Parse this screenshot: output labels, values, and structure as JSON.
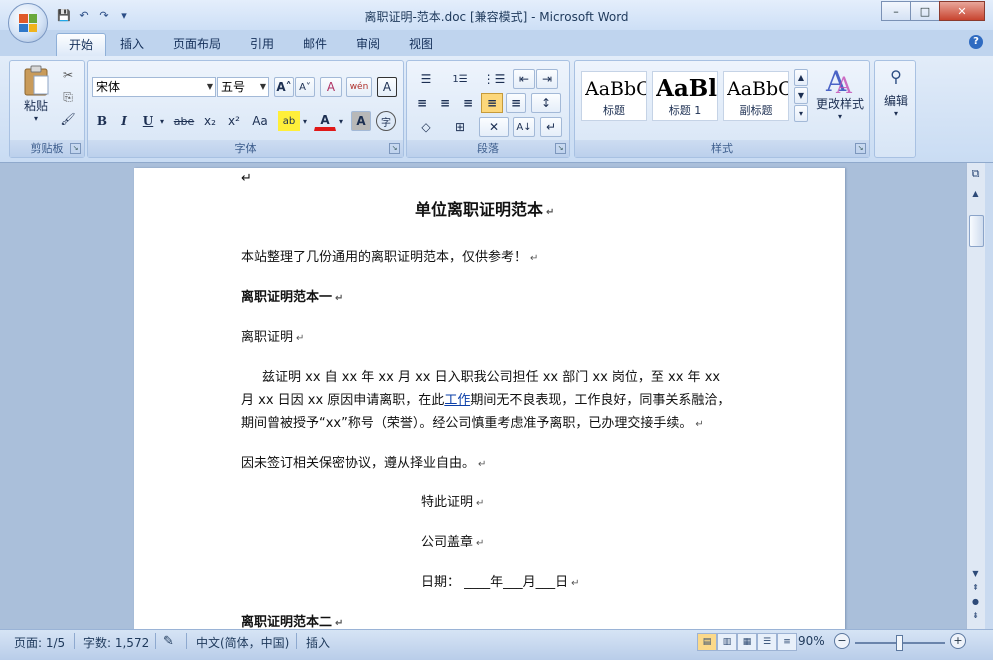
{
  "window": {
    "title": "离职证明-范本.doc [兼容模式] - Microsoft Word",
    "minimize": "–",
    "maximize": "□",
    "close": "✕"
  },
  "qat": {
    "save": "💾",
    "undo": "↶",
    "redo": "↷",
    "more": "▾"
  },
  "tabs": [
    "开始",
    "插入",
    "页面布局",
    "引用",
    "邮件",
    "审阅",
    "视图"
  ],
  "help": "?",
  "ribbon": {
    "clipboard": {
      "label": "剪贴板",
      "paste": "粘贴",
      "paste_arrow": "▾",
      "cut": "✂",
      "copy": "⎘",
      "format_painter": "🖌"
    },
    "font": {
      "label": "字体",
      "font_name": "宋体",
      "font_size": "五号",
      "grow": "A˄",
      "shrink": "A˅",
      "clear": "A",
      "phonetic": "wén",
      "char_border": "A",
      "bold": "B",
      "italic": "I",
      "underline": "U",
      "strike": "abe",
      "sub": "x₂",
      "sup": "x²",
      "case": "Aa",
      "highlight": "ab",
      "font_color": "A",
      "char_shading": "A",
      "enclose": "字"
    },
    "paragraph": {
      "label": "段落",
      "bullets": "☰",
      "numbering": "1☰",
      "multilevel": "⋮☰",
      "decrease_indent": "⇤",
      "increase_indent": "⇥",
      "align_left": "≡",
      "center": "≡",
      "align_right": "≡",
      "justify": "≡",
      "distributed": "≡",
      "line_spacing": "↕",
      "shading": "◇",
      "borders": "⊞",
      "chinese_layout": "✕",
      "sort": "A↓",
      "show_marks": "↵"
    },
    "styles": {
      "label": "样式",
      "items": [
        {
          "sample": "AaBbC",
          "name": "标题"
        },
        {
          "sample": "AaBl",
          "name": "标题 1"
        },
        {
          "sample": "AaBbC",
          "name": "副标题"
        }
      ],
      "change_styles": "更改样式",
      "change_arrow": "▾"
    },
    "editing": {
      "label": "编辑",
      "icon": "⚲",
      "arrow": "▾"
    }
  },
  "document": {
    "top_mark": "↵",
    "title": "单位离职证明范本",
    "intro": "本站整理了几份通用的离职证明范本，仅供参考！",
    "section1": "离职证明范本一",
    "cert_title": "离职证明",
    "body_line1": "兹证明 xx 自 xx 年 xx 月 xx 日入职我公司担任 xx 部门 xx 岗位，至 xx 年 xx",
    "body_line2_a": "月 xx 日因 xx 原因申请离职，在此",
    "body_line2_link": "工作",
    "body_line2_b": "期间无不良表现，工作良好，同事关系融洽，",
    "body_line3": "期间曾被授予“xx”称号（荣誉）。经公司慎重考虑准予离职，已办理交接手续。",
    "confidential": "因未签订相关保密协议，遵从择业自由。",
    "hereby": "特此证明",
    "seal": "公司盖章",
    "date": "日期：  ____年___月___日",
    "section2": "离职证明范本二",
    "para_mark": "↵"
  },
  "statusbar": {
    "page": "页面: 1/5",
    "words": "字数: 1,572",
    "language": "中文(简体，中国)",
    "mode": "插入",
    "zoom": "90%",
    "zoom_out": "−",
    "zoom_in": "+"
  }
}
